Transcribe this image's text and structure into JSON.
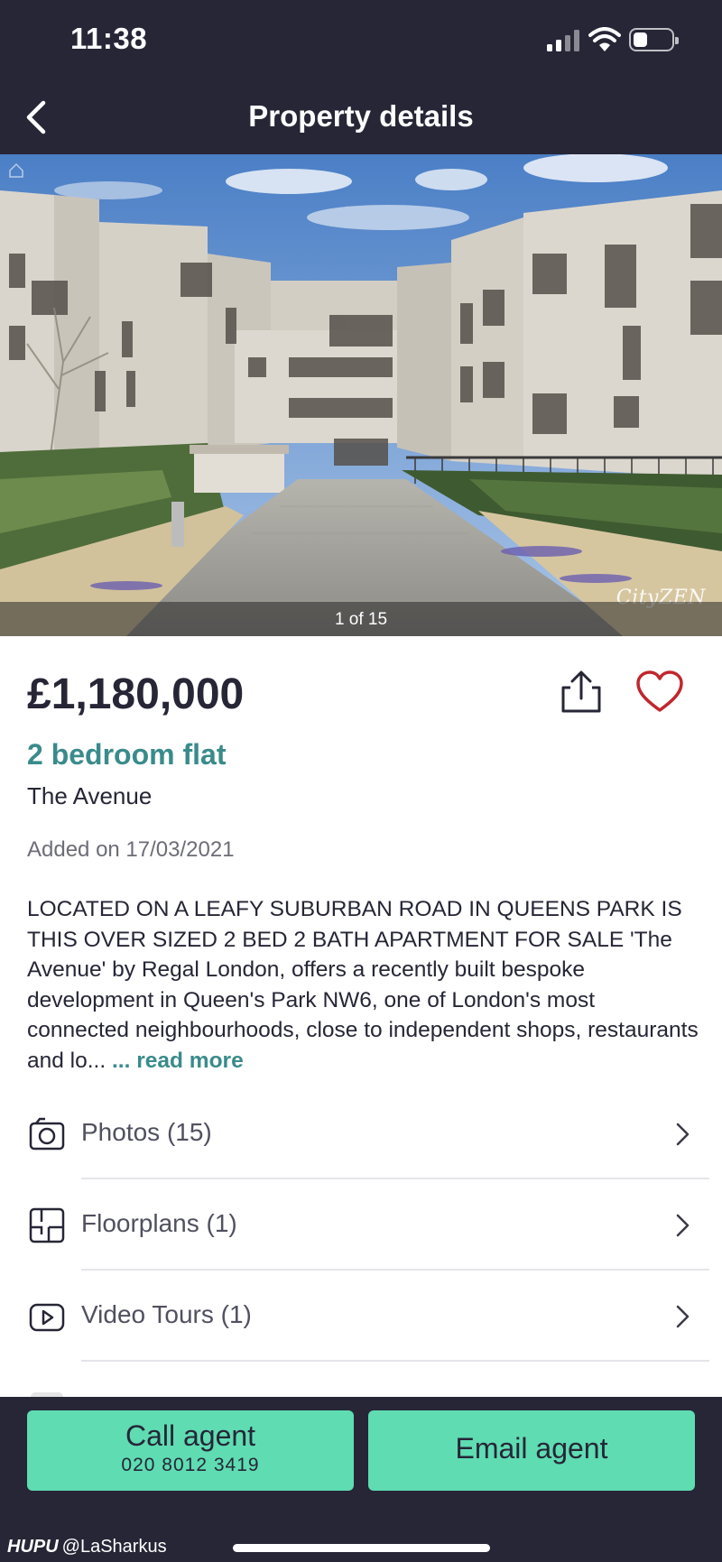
{
  "status_bar": {
    "time": "11:38"
  },
  "nav": {
    "title": "Property details"
  },
  "gallery": {
    "counter": "1 of 15",
    "watermark": "CityZEN"
  },
  "listing": {
    "price": "£1,180,000",
    "property_type": "2 bedroom flat",
    "address": "The Avenue",
    "added": "Added on 17/03/2021",
    "description": "LOCATED ON A LEAFY SUBURBAN ROAD IN QUEENS PARK IS THIS OVER SIZED 2 BED 2 BATH APARTMENT FOR SALE 'The Avenue' by Regal London, offers a recently built bespoke development in Queen's Park NW6, one of London's most connected neighbourhoods, close to independent shops, restaurants and lo...",
    "read_more": " ... read more"
  },
  "media_rows": [
    {
      "label": "Photos (15)",
      "icon": "camera-icon"
    },
    {
      "label": "Floorplans (1)",
      "icon": "floorplan-icon"
    },
    {
      "label": "Video Tours (1)",
      "icon": "video-icon"
    }
  ],
  "actions": {
    "call_label": "Call agent",
    "call_number": "020 8012 3419",
    "email_label": "Email agent"
  },
  "watermark_credit": {
    "brand": "HUPU",
    "handle": "@LaSharkus"
  },
  "colors": {
    "header_bg": "#262637",
    "accent_teal": "#3a8b8b",
    "cta_green": "#5fdcb2",
    "favorite_red": "#c0272d"
  }
}
